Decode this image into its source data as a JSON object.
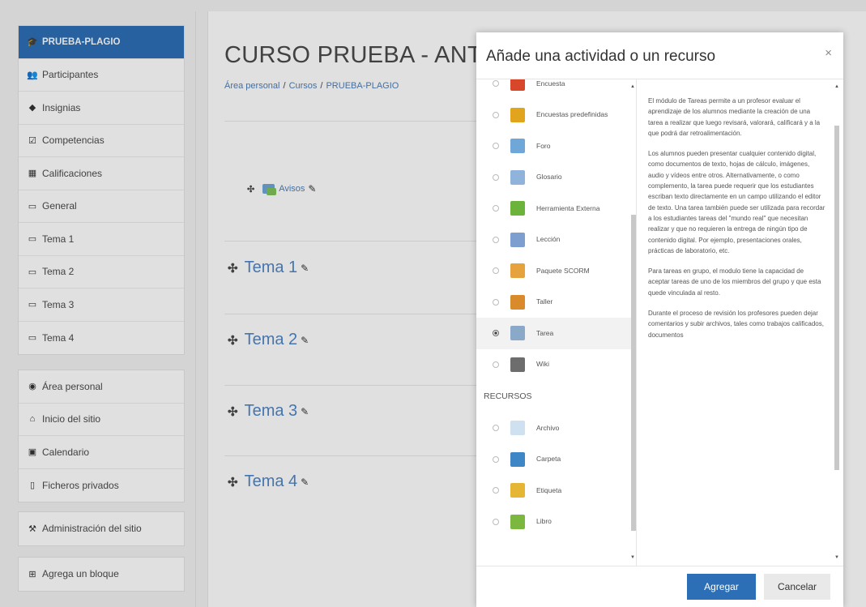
{
  "nav": {
    "course_items": [
      {
        "label": "PRUEBA-PLAGIO",
        "icon": "graduation-cap-icon",
        "active": true
      },
      {
        "label": "Participantes",
        "icon": "users-icon"
      },
      {
        "label": "Insignias",
        "icon": "shield-icon"
      },
      {
        "label": "Competencias",
        "icon": "checkbox-icon"
      },
      {
        "label": "Calificaciones",
        "icon": "table-icon"
      },
      {
        "label": "General",
        "icon": "folder-icon"
      },
      {
        "label": "Tema 1",
        "icon": "folder-icon"
      },
      {
        "label": "Tema 2",
        "icon": "folder-icon"
      },
      {
        "label": "Tema 3",
        "icon": "folder-icon"
      },
      {
        "label": "Tema 4",
        "icon": "folder-icon"
      }
    ],
    "site_items": [
      {
        "label": "Área personal",
        "icon": "dashboard-icon"
      },
      {
        "label": "Inicio del sitio",
        "icon": "home-icon"
      },
      {
        "label": "Calendario",
        "icon": "calendar-icon"
      },
      {
        "label": "Ficheros privados",
        "icon": "file-icon"
      }
    ],
    "admin_label": "Administración del sitio",
    "add_block_label": "Agrega un bloque"
  },
  "page": {
    "course_title": "CURSO PRUEBA - ANTI",
    "breadcrumb": [
      "Área personal",
      "Cursos",
      "PRUEBA-PLAGIO"
    ],
    "avisos_label": "Avisos",
    "topics": [
      "Tema 1",
      "Tema 2",
      "Tema 3",
      "Tema 4"
    ]
  },
  "modal": {
    "title": "Añade una actividad o un recurso",
    "close_glyph": "×",
    "activities": [
      {
        "label": "Encuesta",
        "icon": "survey-icon",
        "color": "#d9472b"
      },
      {
        "label": "Encuestas predefinidas",
        "icon": "chart-icon",
        "color": "#e0a51c"
      },
      {
        "label": "Foro",
        "icon": "forum-icon",
        "color": "#6fa7d9"
      },
      {
        "label": "Glosario",
        "icon": "glossary-icon",
        "color": "#8fb3da"
      },
      {
        "label": "Herramienta Externa",
        "icon": "puzzle-icon",
        "color": "#6bb33a"
      },
      {
        "label": "Lección",
        "icon": "lesson-icon",
        "color": "#7c9fcf"
      },
      {
        "label": "Paquete SCORM",
        "icon": "scorm-icon",
        "color": "#e6a23c"
      },
      {
        "label": "Taller",
        "icon": "workshop-icon",
        "color": "#d98b2b"
      },
      {
        "label": "Tarea",
        "icon": "assignment-icon",
        "color": "#8aa9c9",
        "selected": true
      },
      {
        "label": "Wiki",
        "icon": "wiki-icon",
        "color": "#6d6d6d"
      }
    ],
    "resources_header": "RECURSOS",
    "resources": [
      {
        "label": "Archivo",
        "icon": "file-icon",
        "color": "#cfe0f1"
      },
      {
        "label": "Carpeta",
        "icon": "folder-icon",
        "color": "#3f86c7"
      },
      {
        "label": "Etiqueta",
        "icon": "tag-icon",
        "color": "#e5b534"
      },
      {
        "label": "Libro",
        "icon": "book-icon",
        "color": "#7cb83f"
      }
    ],
    "help_paragraphs": [
      "El módulo de Tareas permite a un profesor evaluar el aprendizaje de los alumnos mediante la creación de una tarea a realizar que luego revisará, valorará, calificará y a la que podrá dar retroalimentación.",
      "Los alumnos pueden presentar cualquier contenido digital, como documentos de texto, hojas de cálculo, imágenes, audio y vídeos entre otros. Alternativamente, o como complemento, la tarea puede requerir que los estudiantes escriban texto directamente en un campo utilizando el editor de texto. Una tarea también puede ser utilizada para recordar a los estudiantes tareas del \"mundo real\" que necesitan realizar y que no requieren la entrega de ningún tipo de contenido digital. Por ejemplo, presentaciones orales, prácticas de laboratorio, etc.",
      "Para tareas en grupo, el modulo tiene la capacidad de aceptar tareas de uno de los miembros del grupo y que esta quede vinculada al resto.",
      "Durante el proceso de revisión los profesores pueden dejar comentarios y subir archivos, tales como trabajos calificados, documentos"
    ],
    "add_label": "Agregar",
    "cancel_label": "Cancelar"
  }
}
